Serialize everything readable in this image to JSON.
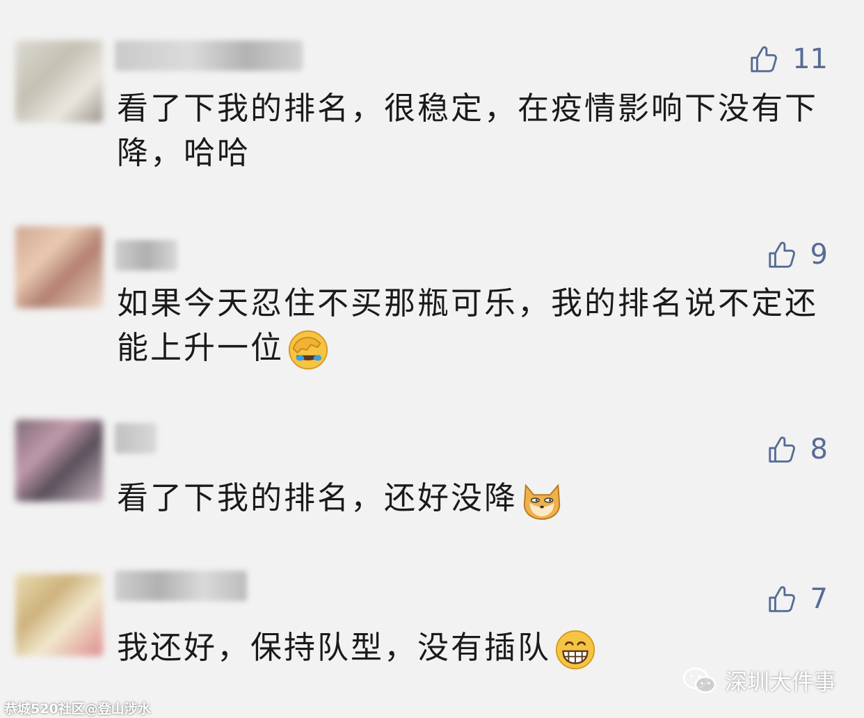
{
  "comments": [
    {
      "text": "看了下我的排名，很稳定，在疫情影响下没有下降，哈哈",
      "likes": "11",
      "emoji": ""
    },
    {
      "text": "如果今天忍住不买那瓶可乐，我的排名说不定还能上升一位",
      "likes": "9",
      "emoji": "facepalm-laughing-emoji"
    },
    {
      "text": "看了下我的排名，还好没降",
      "likes": "8",
      "emoji": "doge-emoji"
    },
    {
      "text": "我还好，保持队型，没有插队",
      "likes": "7",
      "emoji": "grinning-emoji"
    }
  ],
  "source": {
    "account": "深圳大件事",
    "icon": "wechat-icon"
  },
  "watermark": "恭城520社区@登山涉水",
  "colors": {
    "background": "#f2f2f2",
    "like": "#576b95",
    "text": "#1a1a1a"
  }
}
